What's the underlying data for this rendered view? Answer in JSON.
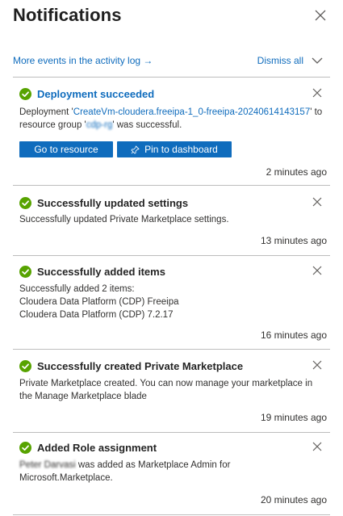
{
  "panel": {
    "title": "Notifications",
    "close_icon": "close-icon"
  },
  "toolbar": {
    "activity_link": "More events in the activity log →",
    "dismiss_all": "Dismiss all",
    "dismiss_icon": "chevron-down-icon"
  },
  "colors": {
    "accent": "#0f6cbd",
    "success": "#57a300",
    "divider": "#bdbdbd"
  },
  "notifications": [
    {
      "title": "Deployment succeeded",
      "body_prefix": "Deployment '",
      "body_link": "CreateVm-cloudera.freeipa-1_0-freeipa-20240614143157",
      "body_mid": "' to resource group '",
      "body_group": "cdp-rg",
      "body_suffix": "' was successful.",
      "buttons": [
        "Go to resource",
        "Pin to dashboard"
      ],
      "time": "2 minutes ago",
      "icon": "success-check-icon"
    },
    {
      "title": "Successfully updated settings",
      "body": "Successfully updated Private Marketplace settings.",
      "time": "13 minutes ago",
      "icon": "success-check-icon"
    },
    {
      "title": "Successfully added items",
      "body_lines": [
        "Successfully added 2 items:",
        "Cloudera Data Platform (CDP) Freeipa",
        "Cloudera Data Platform (CDP) 7.2.17"
      ],
      "time": "16 minutes ago",
      "icon": "success-check-icon"
    },
    {
      "title": "Successfully created Private Marketplace",
      "body_lines": [
        "Private Marketplace created. You can now manage your marketplace in",
        "the Manage Marketplace blade"
      ],
      "time": "19 minutes ago",
      "icon": "success-check-icon"
    },
    {
      "title": "Added Role assignment",
      "body_user": "Peter Darvasi",
      "body_rest": " was added as Marketplace Admin for",
      "body_line2": "Microsoft.Marketplace.",
      "time": "20 minutes ago",
      "icon": "success-check-icon"
    }
  ]
}
